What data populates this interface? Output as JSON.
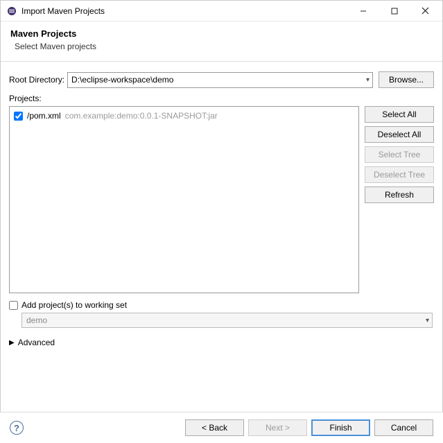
{
  "titlebar": {
    "title": "Import Maven Projects"
  },
  "header": {
    "title": "Maven Projects",
    "subtitle": "Select Maven projects"
  },
  "rootDirectory": {
    "label": "Root Directory:",
    "value": "D:\\eclipse-workspace\\demo",
    "browse": "Browse..."
  },
  "projects": {
    "label": "Projects:",
    "items": [
      {
        "checked": true,
        "path": "/pom.xml",
        "artifact": "com.example:demo:0.0.1-SNAPSHOT:jar"
      }
    ]
  },
  "sideButtons": {
    "selectAll": "Select All",
    "deselectAll": "Deselect All",
    "selectTree": "Select Tree",
    "deselectTree": "Deselect Tree",
    "refresh": "Refresh"
  },
  "workingSet": {
    "checkboxLabel": "Add project(s) to working set",
    "value": "demo"
  },
  "advanced": {
    "label": "Advanced"
  },
  "footer": {
    "back": "< Back",
    "next": "Next >",
    "finish": "Finish",
    "cancel": "Cancel"
  }
}
